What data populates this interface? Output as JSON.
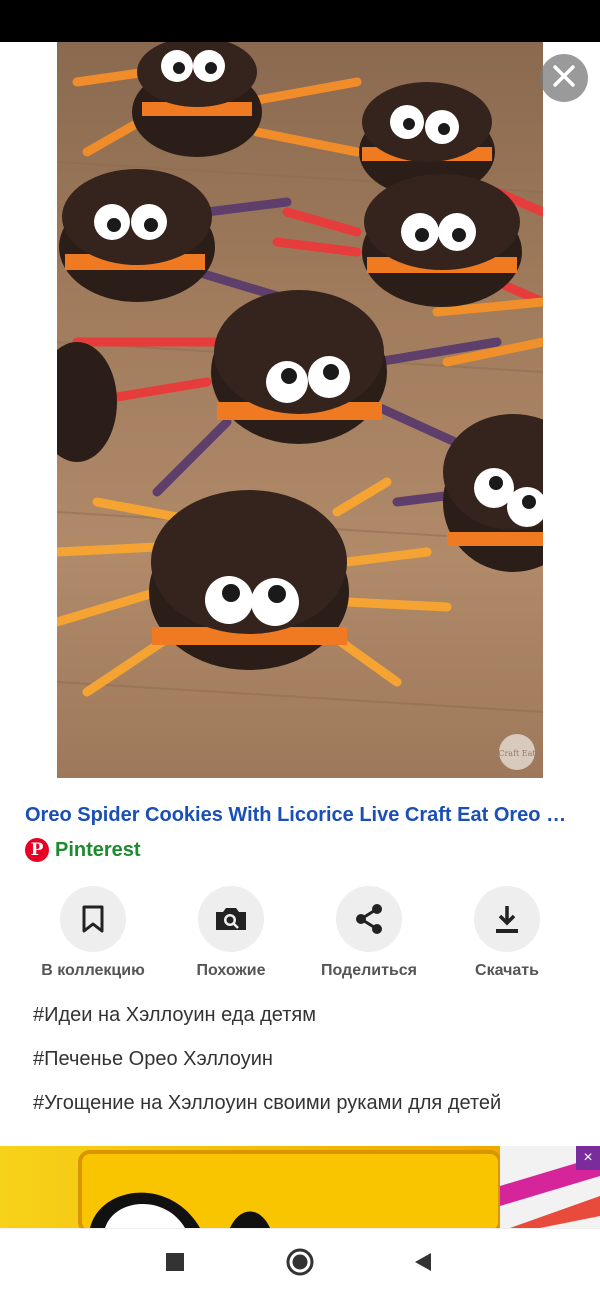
{
  "result": {
    "title": "Oreo Spider Cookies With Licorice Live Craft Eat Oreo s…",
    "source_name": "Pinterest",
    "source_logo": "P"
  },
  "image": {
    "watermark": "Craft Eat"
  },
  "actions": [
    {
      "label": "В коллекцию",
      "icon": "bookmark-icon"
    },
    {
      "label": "Похожие",
      "icon": "camera-search-icon"
    },
    {
      "label": "Поделиться",
      "icon": "share-icon"
    },
    {
      "label": "Скачать",
      "icon": "download-icon"
    }
  ],
  "tags": [
    "#Идеи на Хэллоуин еда детям",
    "#Печенье Орео Хэллоуин",
    "#Угощение на Хэллоуин своими руками для детей"
  ],
  "colors": {
    "title": "#1a4fb5",
    "source": "#1d8a2f",
    "pinterest_red": "#e60023"
  }
}
